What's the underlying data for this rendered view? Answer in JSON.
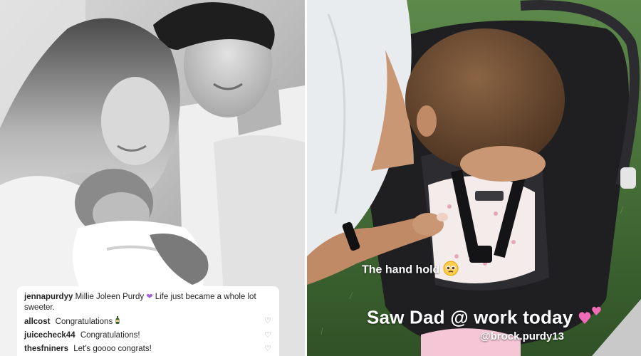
{
  "left_photo": {
    "style": "black-and-white",
    "subject": "couple-holding-newborn"
  },
  "comments": {
    "first": {
      "user": "jennapurdyy",
      "text": "Millie Joleen Purdy",
      "text_after_emoji": "Life just became a whole lot sweeter.",
      "emoji": "purple-heart"
    },
    "items": [
      {
        "user": "allcost",
        "text": "Congratulations",
        "emoji": "bottle"
      },
      {
        "user": "juicecheck44",
        "text": "Congratulations!"
      },
      {
        "user": "thesfniners",
        "text": "Let's goooo congrats!"
      }
    ],
    "like_icon": "heart-outline-icon"
  },
  "right_story": {
    "caption1": "The hand hold",
    "caption1_emoji": "pleading-face",
    "caption2": "Saw Dad @ work today",
    "caption2_emoji": "two-hearts",
    "mention": "@brock.purdy13"
  },
  "colors": {
    "grass": "#3f6b34",
    "shirt": "#e9ecef",
    "hair": "#6b4a30",
    "carseat": "#1f1f22",
    "heart_purple": "#a05fd6",
    "heart_pink": "#f06bb6"
  }
}
